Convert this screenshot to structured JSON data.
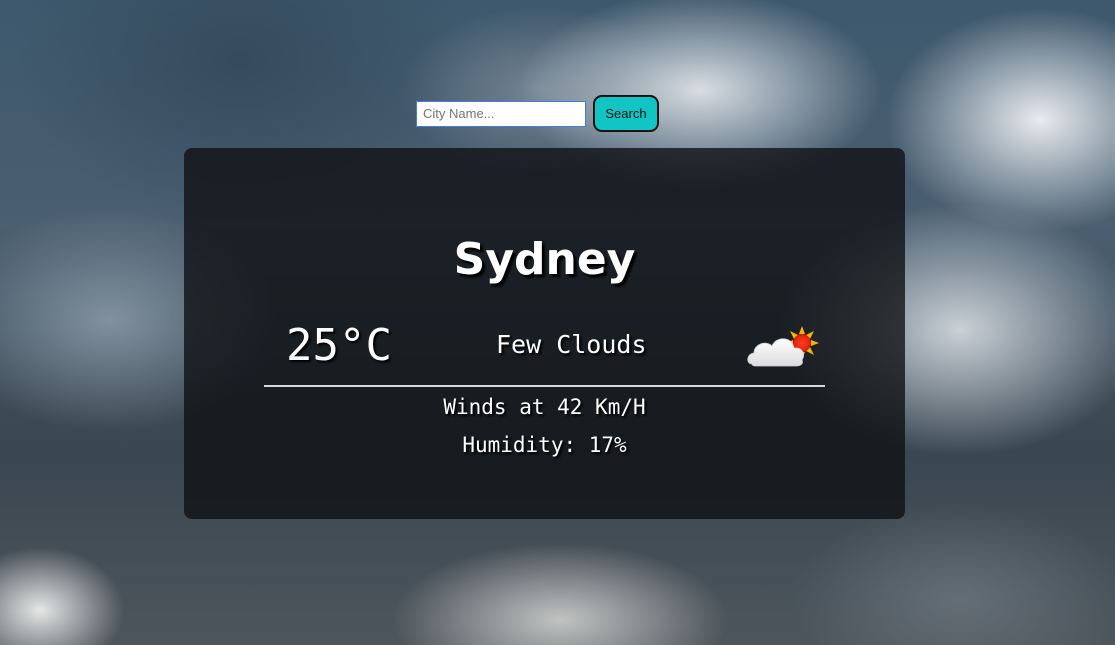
{
  "search": {
    "placeholder": "City Name...",
    "value": "",
    "button_label": "Search"
  },
  "weather": {
    "city": "Sydney",
    "temperature": "25°C",
    "description": "Few Clouds",
    "icon": "few-clouds-day-icon",
    "wind": "Winds at 42 Km/H",
    "humidity": "Humidity: 17%"
  },
  "colors": {
    "button_background": "#12c5c5",
    "card_background": "rgba(14,16,18,0.78)",
    "text": "#ffffff",
    "input_border": "#4a7bd8"
  }
}
